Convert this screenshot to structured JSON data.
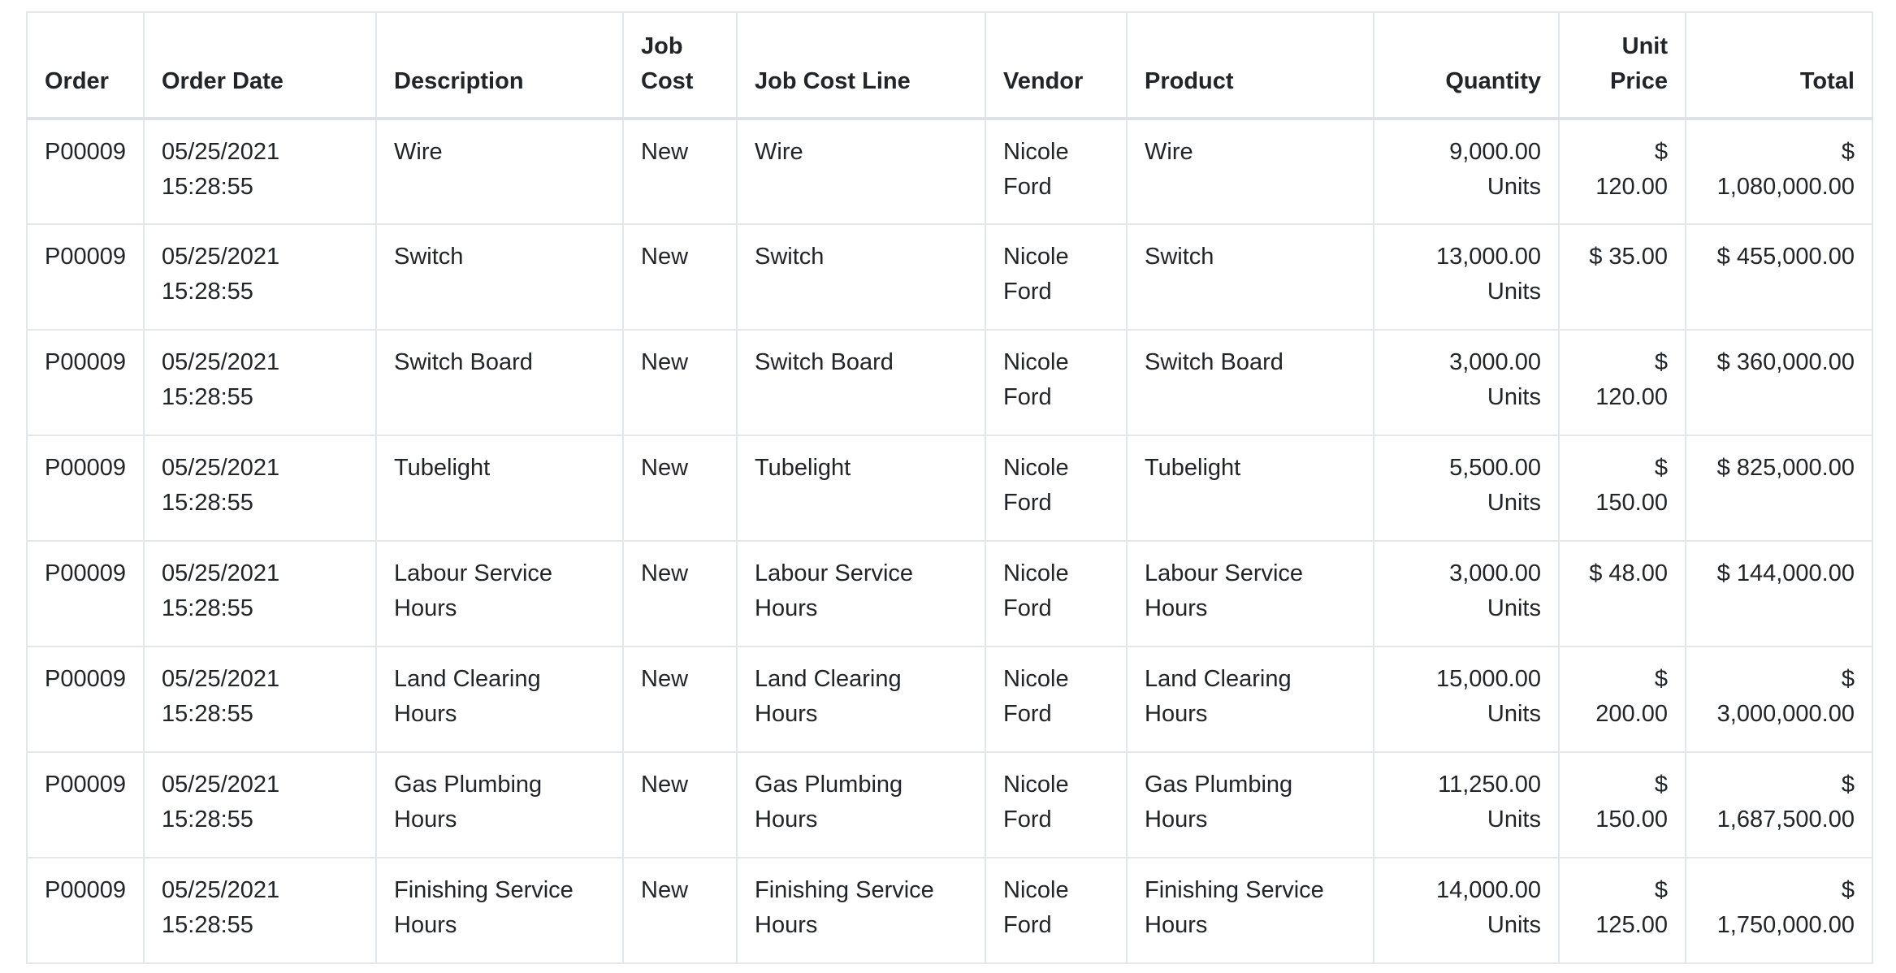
{
  "columns": [
    {
      "key": "order",
      "label": "Order",
      "align": "left"
    },
    {
      "key": "order_date",
      "label": "Order Date",
      "align": "left"
    },
    {
      "key": "description",
      "label": "Description",
      "align": "left"
    },
    {
      "key": "job_cost",
      "label": "Job Cost",
      "align": "left"
    },
    {
      "key": "job_cost_line",
      "label": "Job Cost Line",
      "align": "left"
    },
    {
      "key": "vendor",
      "label": "Vendor",
      "align": "left"
    },
    {
      "key": "product",
      "label": "Product",
      "align": "left"
    },
    {
      "key": "quantity",
      "label": "Quantity",
      "align": "right"
    },
    {
      "key": "unit_price",
      "label": "Unit Price",
      "align": "right"
    },
    {
      "key": "total",
      "label": "Total",
      "align": "right"
    }
  ],
  "rows": [
    {
      "order": "P00009",
      "order_date": "05/25/2021 15:28:55",
      "description": "Wire",
      "job_cost": "New",
      "job_cost_line": "Wire",
      "vendor": "Nicole Ford",
      "product": "Wire",
      "quantity": "9,000.00 Units",
      "unit_price": "$ 120.00",
      "total": "$ 1,080,000.00"
    },
    {
      "order": "P00009",
      "order_date": "05/25/2021 15:28:55",
      "description": "Switch",
      "job_cost": "New",
      "job_cost_line": "Switch",
      "vendor": "Nicole Ford",
      "product": "Switch",
      "quantity": "13,000.00 Units",
      "unit_price": "$ 35.00",
      "total": "$ 455,000.00"
    },
    {
      "order": "P00009",
      "order_date": "05/25/2021 15:28:55",
      "description": "Switch Board",
      "job_cost": "New",
      "job_cost_line": "Switch Board",
      "vendor": "Nicole Ford",
      "product": "Switch Board",
      "quantity": "3,000.00 Units",
      "unit_price": "$ 120.00",
      "total": "$ 360,000.00"
    },
    {
      "order": "P00009",
      "order_date": "05/25/2021 15:28:55",
      "description": "Tubelight",
      "job_cost": "New",
      "job_cost_line": "Tubelight",
      "vendor": "Nicole Ford",
      "product": "Tubelight",
      "quantity": "5,500.00 Units",
      "unit_price": "$ 150.00",
      "total": "$ 825,000.00"
    },
    {
      "order": "P00009",
      "order_date": "05/25/2021 15:28:55",
      "description": "Labour Service Hours",
      "job_cost": "New",
      "job_cost_line": "Labour Service Hours",
      "vendor": "Nicole Ford",
      "product": "Labour Service Hours",
      "quantity": "3,000.00 Units",
      "unit_price": "$ 48.00",
      "total": "$ 144,000.00"
    },
    {
      "order": "P00009",
      "order_date": "05/25/2021 15:28:55",
      "description": "Land Clearing Hours",
      "job_cost": "New",
      "job_cost_line": "Land Clearing Hours",
      "vendor": "Nicole Ford",
      "product": "Land Clearing Hours",
      "quantity": "15,000.00 Units",
      "unit_price": "$ 200.00",
      "total": "$ 3,000,000.00"
    },
    {
      "order": "P00009",
      "order_date": "05/25/2021 15:28:55",
      "description": "Gas Plumbing Hours",
      "job_cost": "New",
      "job_cost_line": "Gas Plumbing Hours",
      "vendor": "Nicole Ford",
      "product": "Gas Plumbing Hours",
      "quantity": "11,250.00 Units",
      "unit_price": "$ 150.00",
      "total": "$ 1,687,500.00"
    },
    {
      "order": "P00009",
      "order_date": "05/25/2021 15:28:55",
      "description": "Finishing Service Hours",
      "job_cost": "New",
      "job_cost_line": "Finishing Service Hours",
      "vendor": "Nicole Ford",
      "product": "Finishing Service Hours",
      "quantity": "14,000.00 Units",
      "unit_price": "$ 125.00",
      "total": "$ 1,750,000.00"
    }
  ]
}
